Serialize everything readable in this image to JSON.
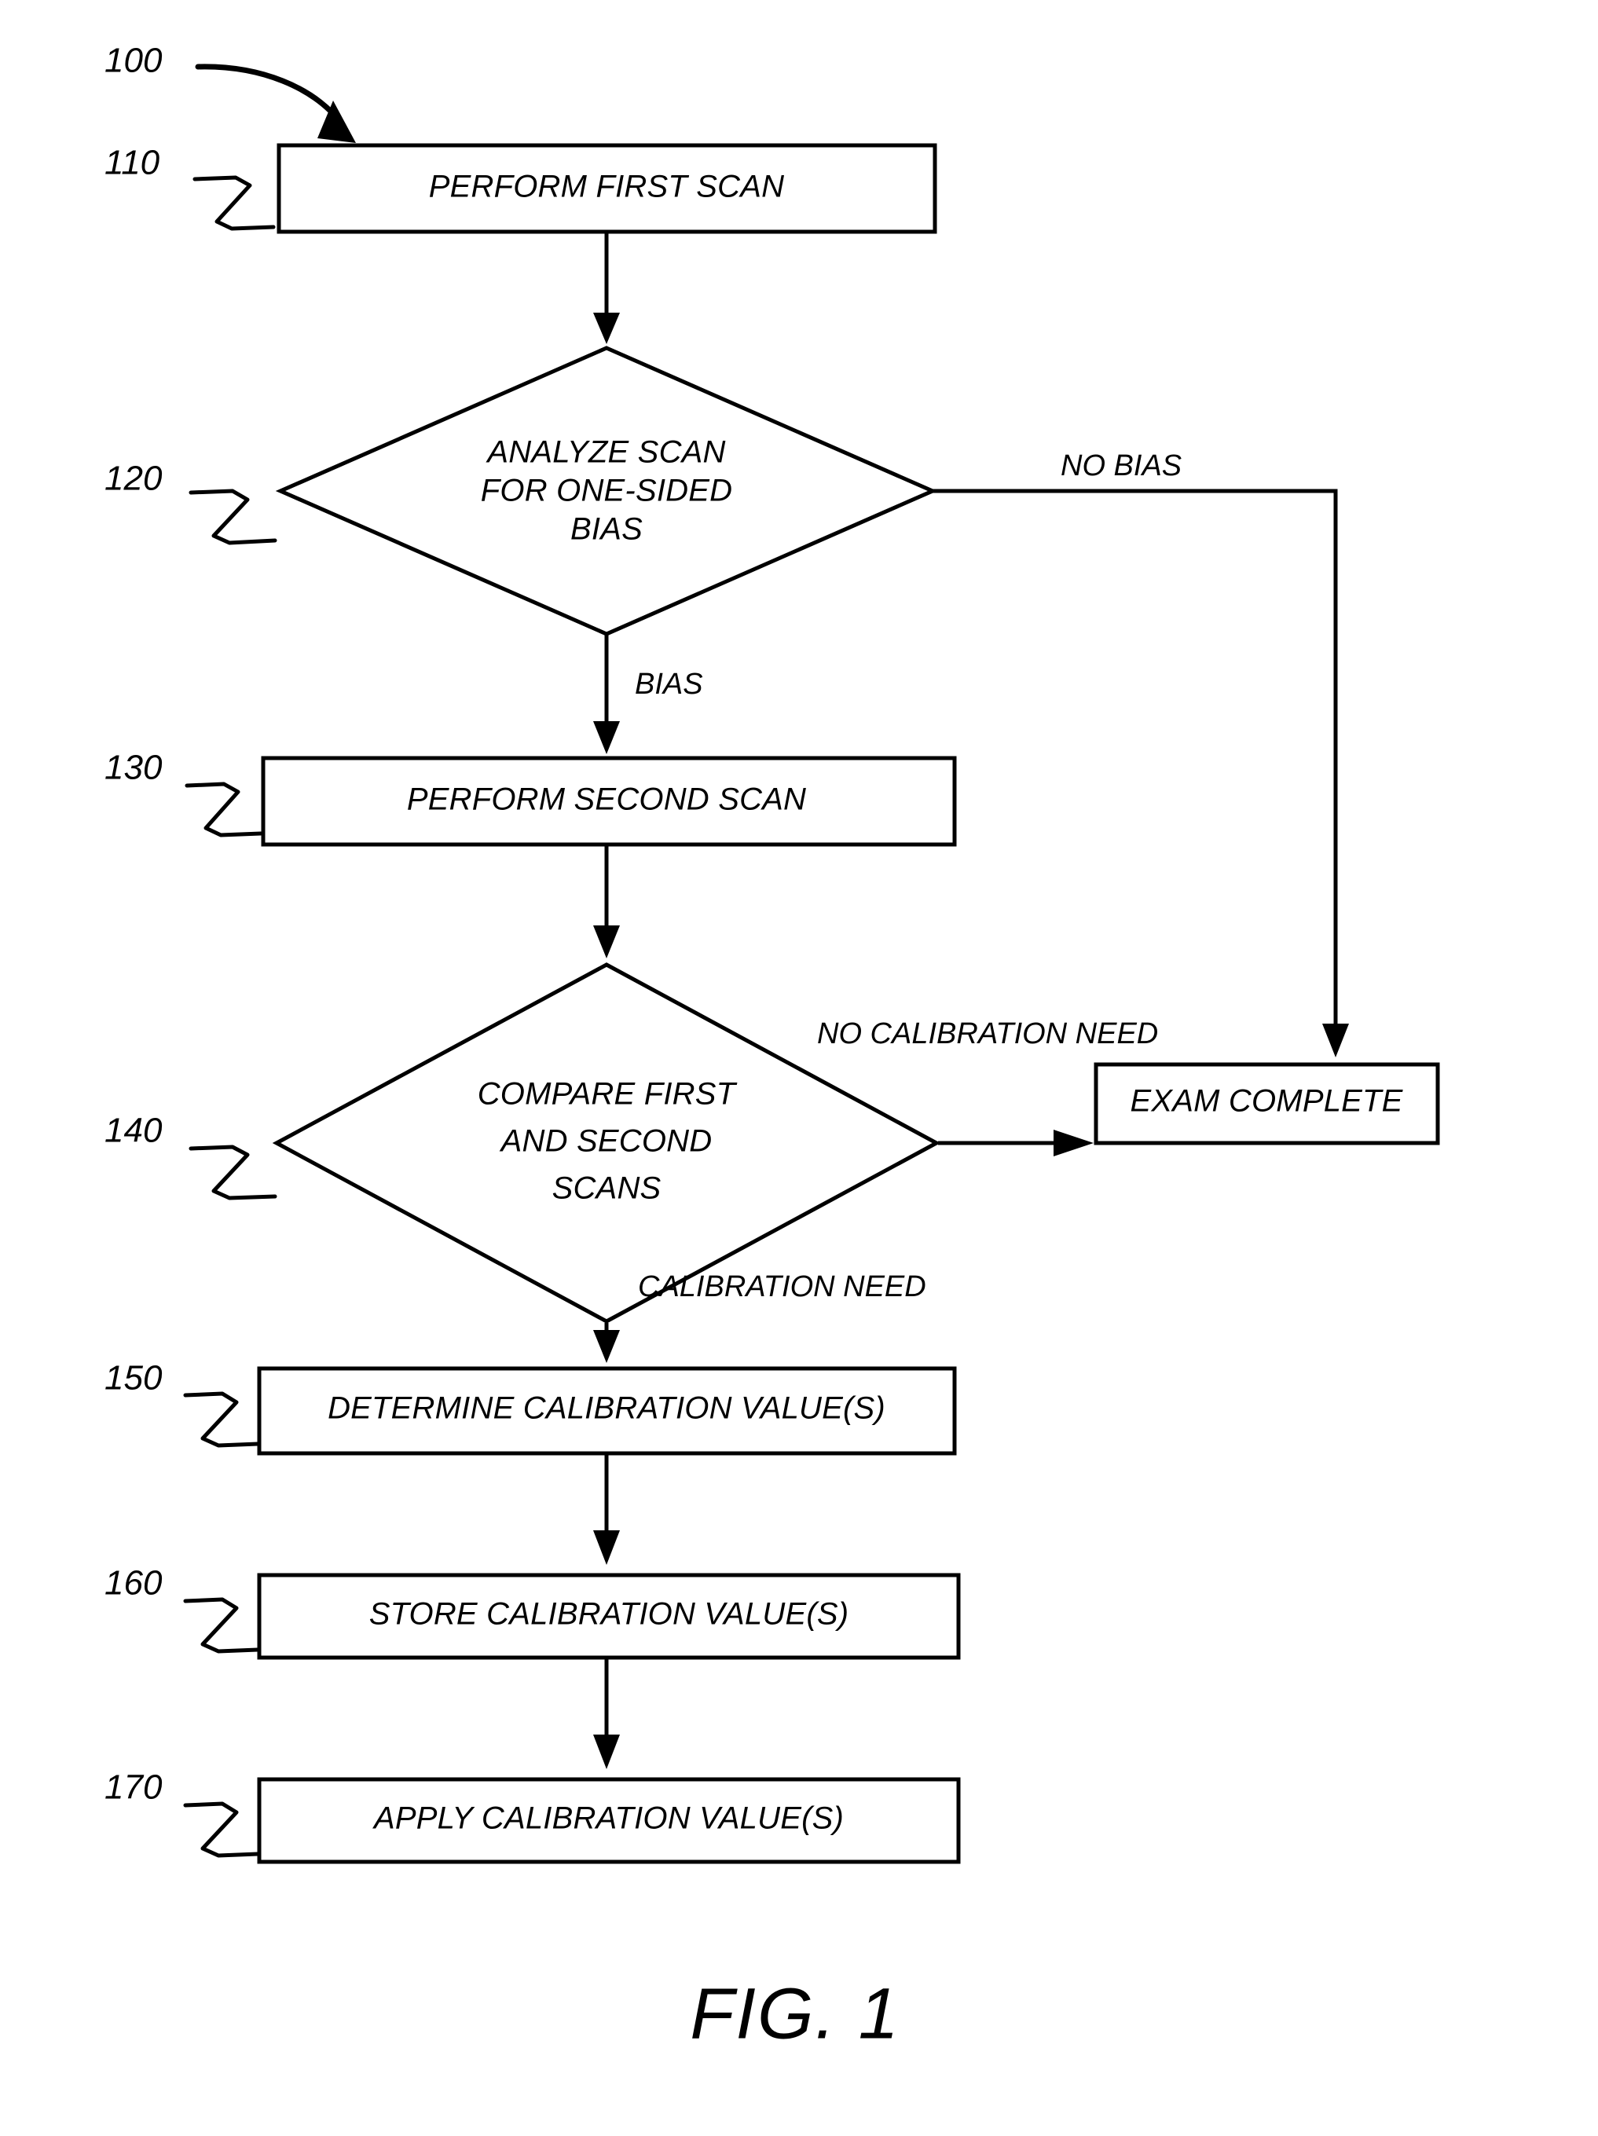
{
  "figure": {
    "caption": "FIG. 1",
    "diagram_ref": "100"
  },
  "nodes": [
    {
      "ref": "110",
      "type": "process",
      "lines": [
        "PERFORM FIRST SCAN"
      ]
    },
    {
      "ref": "120",
      "type": "decision",
      "lines": [
        "ANALYZE SCAN",
        "FOR ONE-SIDED",
        "BIAS"
      ]
    },
    {
      "ref": "130",
      "type": "process",
      "lines": [
        "PERFORM SECOND SCAN"
      ]
    },
    {
      "ref": "140",
      "type": "decision",
      "lines": [
        "COMPARE FIRST",
        "AND SECOND",
        "SCANS"
      ]
    },
    {
      "ref": "150",
      "type": "process",
      "lines": [
        "DETERMINE CALIBRATION VALUE(S)"
      ]
    },
    {
      "ref": "160",
      "type": "process",
      "lines": [
        "STORE CALIBRATION VALUE(S)"
      ]
    },
    {
      "ref": "170",
      "type": "process",
      "lines": [
        "APPLY CALIBRATION VALUE(S)"
      ]
    },
    {
      "ref": "",
      "type": "terminal",
      "lines": [
        "EXAM COMPLETE"
      ]
    }
  ],
  "edge_labels": {
    "no_bias": "NO BIAS",
    "bias": "BIAS",
    "no_calibration_need": "NO CALIBRATION NEED",
    "calibration_need": "CALIBRATION NEED"
  },
  "colors": {
    "ink": "#000000",
    "paper": "#ffffff"
  }
}
